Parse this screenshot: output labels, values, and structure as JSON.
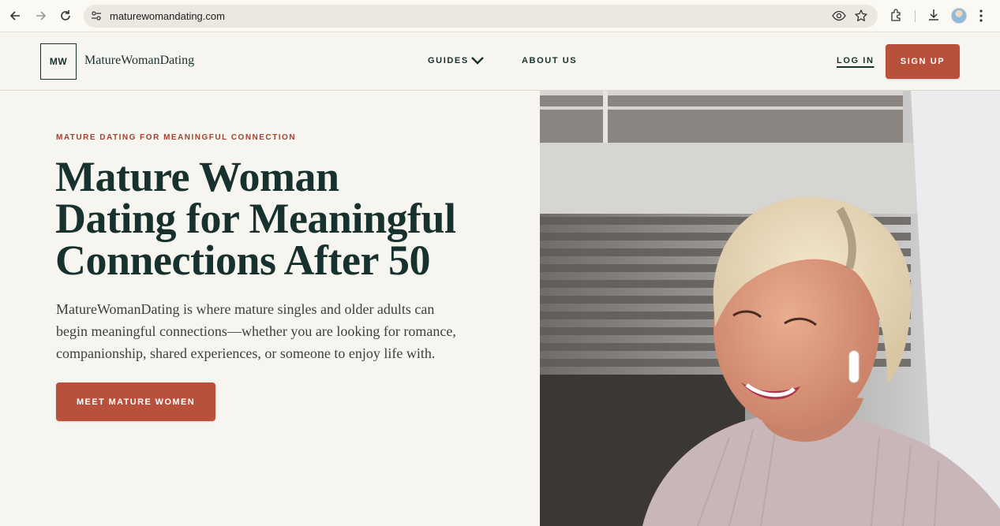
{
  "browser": {
    "url": "maturewomandating.com"
  },
  "header": {
    "logo_mark": "MW",
    "logo_text": "MatureWomanDating",
    "nav": {
      "guides": "GUIDES",
      "about": "ABOUT US",
      "login": "LOG IN",
      "signup": "SIGN UP"
    }
  },
  "hero": {
    "eyebrow": "MATURE DATING FOR MEANINGFUL CONNECTION",
    "title_lines": [
      "Mature Woman",
      "Dating for Meaningful",
      "Connections After 50"
    ],
    "body": "MatureWomanDating is where mature singles and older adults can begin meaningful connections—whether you are looking for romance, companionship, shared experiences, or someone to enjoy life with.",
    "cta": "MEET MATURE WOMEN"
  },
  "colors": {
    "accent": "#b8503b",
    "ink": "#17322e",
    "background": "#f7f5ef",
    "eyebrow": "#a2412f"
  },
  "icons": [
    "back-arrow-icon",
    "forward-arrow-icon",
    "reload-icon",
    "site-settings-icon",
    "eye-icon",
    "star-icon",
    "extensions-icon",
    "download-icon",
    "profile-avatar",
    "kebab-menu-icon",
    "chevron-down-icon"
  ]
}
